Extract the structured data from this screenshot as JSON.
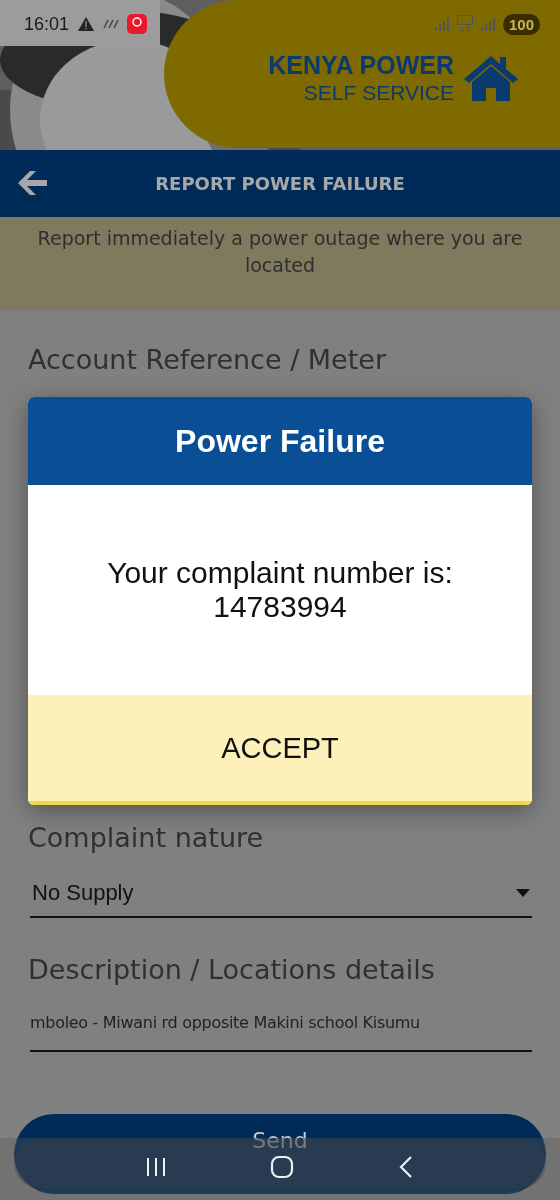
{
  "status_bar": {
    "time": "16:01",
    "battery": "100"
  },
  "header": {
    "brand": "KENYA POWER",
    "subtitle": "SELF SERVICE"
  },
  "nav": {
    "title": "REPORT POWER FAILURE"
  },
  "banner": {
    "text": "Report immediately a power outage where you are located"
  },
  "form": {
    "meter_label": "Account Reference / Meter",
    "complaint_label": "Complaint nature",
    "complaint_value": "No Supply",
    "description_label": "Description / Locations details",
    "description_value": "mboleo - Miwani rd opposite Makini school Kisumu"
  },
  "send_button": "Send",
  "dialog": {
    "title": "Power Failure",
    "message": "Your complaint number is:",
    "number": "14783994",
    "button": "ACCEPT"
  }
}
